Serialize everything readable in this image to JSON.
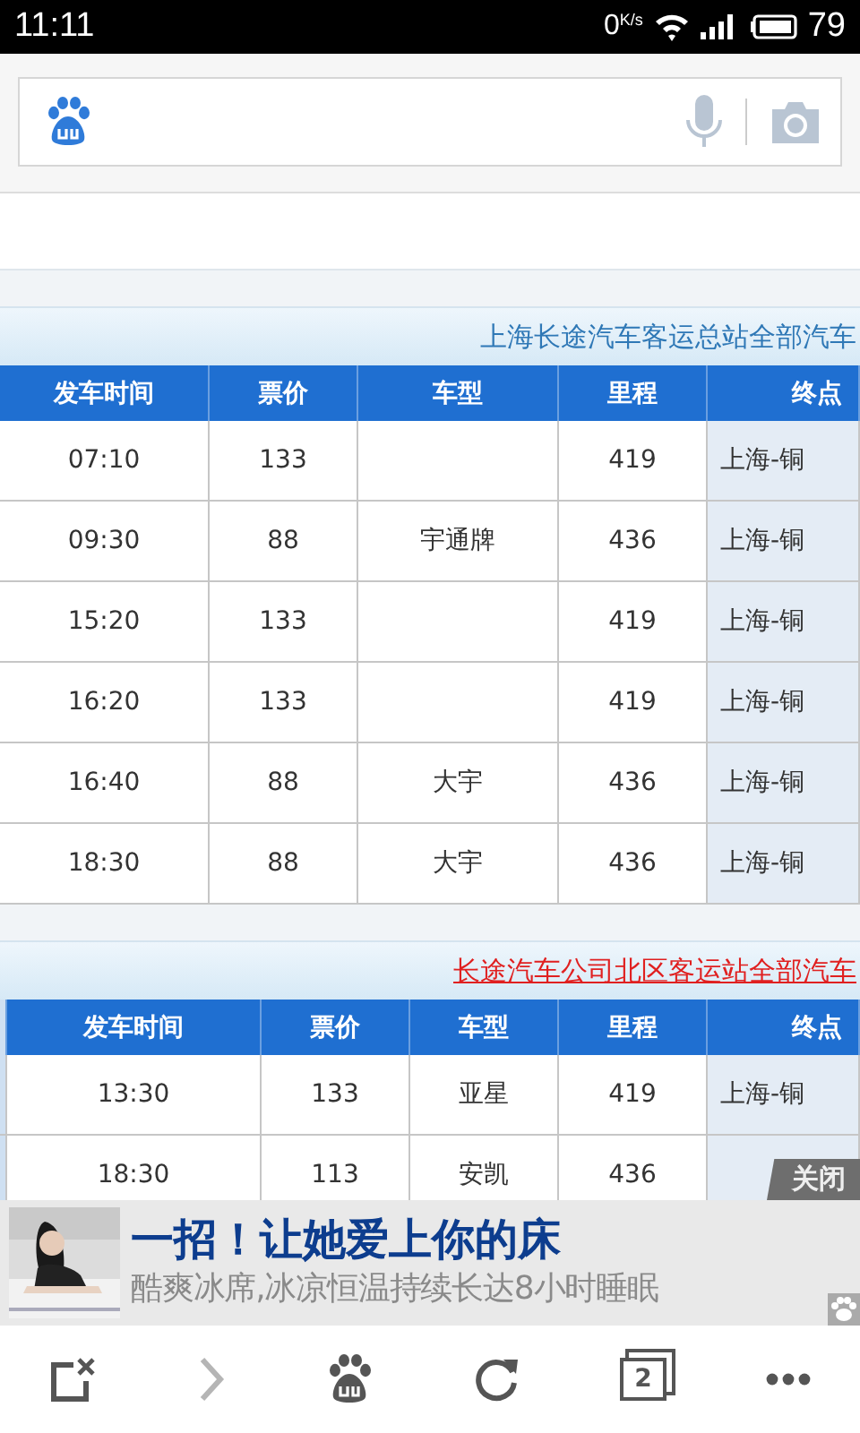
{
  "status_bar": {
    "time": "11:11",
    "net_speed": "0",
    "net_unit": "K/s",
    "battery": "79"
  },
  "tables": [
    {
      "title": "上海长途汽车客运总站全部汽车",
      "link": false,
      "lead_column": false,
      "columns": [
        "发车时间",
        "票价",
        "车型",
        "里程",
        "终点"
      ],
      "rows": [
        [
          "07:10",
          "133",
          "",
          "419",
          "上海-铜"
        ],
        [
          "09:30",
          "88",
          "宇通牌",
          "436",
          "上海-铜"
        ],
        [
          "15:20",
          "133",
          "",
          "419",
          "上海-铜"
        ],
        [
          "16:20",
          "133",
          "",
          "419",
          "上海-铜"
        ],
        [
          "16:40",
          "88",
          "大宇",
          "436",
          "上海-铜"
        ],
        [
          "18:30",
          "88",
          "大宇",
          "436",
          "上海-铜"
        ]
      ]
    },
    {
      "title": "长途汽车公司北区客运站全部汽车",
      "link": true,
      "lead_column": true,
      "columns": [
        "发车时间",
        "票价",
        "车型",
        "里程",
        "终点"
      ],
      "rows": [
        [
          "13:30",
          "133",
          "亚星",
          "419",
          "上海-铜"
        ],
        [
          "18:30",
          "113",
          "安凯",
          "436"
        ]
      ]
    }
  ],
  "ad": {
    "headline": "一招！让她爱上你的床",
    "text": "酷爽冰席,冰凉恒温持续长达8小时睡眠",
    "close_label": "关闭"
  },
  "toolbar": {
    "forward_disabled": true,
    "tab_count": "2"
  }
}
